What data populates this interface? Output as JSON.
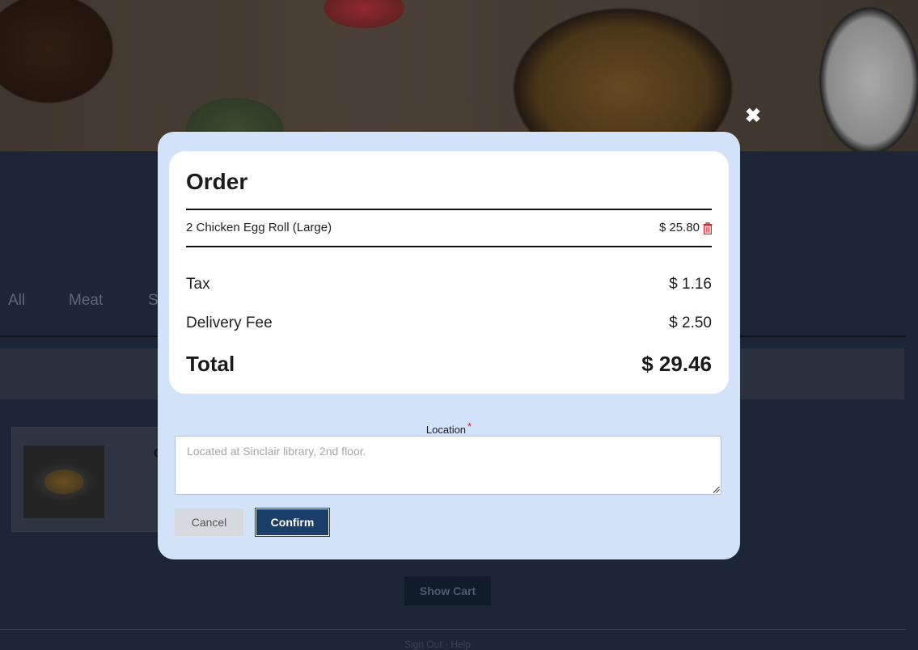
{
  "background": {
    "filters": [
      "All",
      "Meat",
      "S"
    ],
    "card_letter": "C",
    "show_cart_label": "Show Cart",
    "footer_text": "Sign Out · Help"
  },
  "modal": {
    "close_icon": "close-icon",
    "order": {
      "title": "Order",
      "items": [
        {
          "name": "2 Chicken Egg Roll (Large)",
          "price": "$ 25.80",
          "delete_icon": "trash-icon"
        }
      ],
      "tax_label": "Tax",
      "tax_value": "$ 1.16",
      "delivery_label": "Delivery Fee",
      "delivery_value": "$ 2.50",
      "total_label": "Total",
      "total_value": "$ 29.46"
    },
    "location": {
      "label": "Location",
      "required_mark": "*",
      "placeholder": "Located at Sinclair library, 2nd floor.",
      "value": ""
    },
    "buttons": {
      "cancel": "Cancel",
      "confirm": "Confirm"
    }
  },
  "colors": {
    "modal_bg": "#d2e2f8",
    "confirm_bg": "#1a3e6a",
    "trash": "#d8232a",
    "required": "#d8232a",
    "page_bg": "#1d2636"
  }
}
